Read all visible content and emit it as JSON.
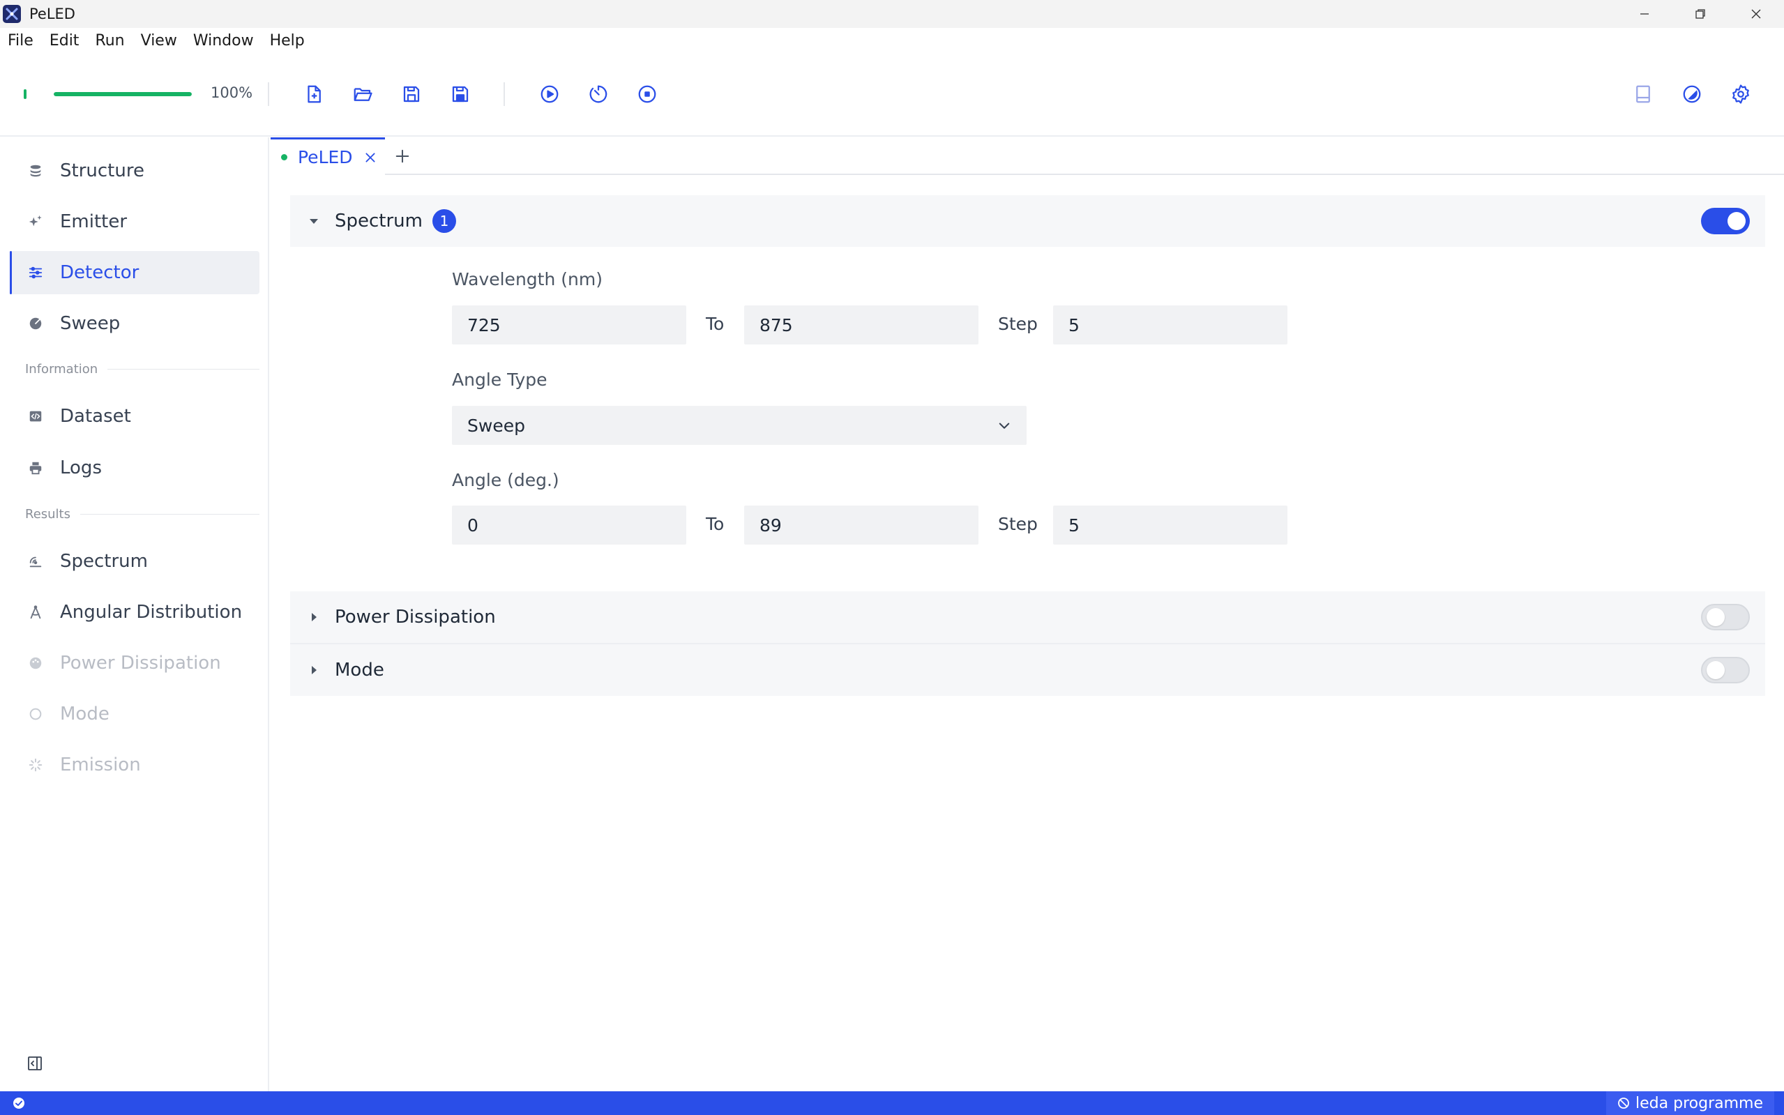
{
  "window": {
    "title": "PeLED"
  },
  "menu": [
    "File",
    "Edit",
    "Run",
    "View",
    "Window",
    "Help"
  ],
  "toolbar": {
    "progress_value": 100,
    "progress_text": "100%"
  },
  "sidebar": {
    "items": [
      {
        "label": "Structure"
      },
      {
        "label": "Emitter"
      },
      {
        "label": "Detector"
      },
      {
        "label": "Sweep"
      }
    ],
    "information_title": "Information",
    "information_items": [
      {
        "label": "Dataset"
      },
      {
        "label": "Logs"
      }
    ],
    "results_title": "Results",
    "results_items": [
      {
        "label": "Spectrum"
      },
      {
        "label": "Angular Distribution"
      },
      {
        "label": "Power Dissipation"
      },
      {
        "label": "Mode"
      },
      {
        "label": "Emission"
      }
    ]
  },
  "tabs": [
    {
      "label": "PeLED"
    }
  ],
  "panel": {
    "spectrum": {
      "title": "Spectrum",
      "badge": "1",
      "enabled": true,
      "wavelength_label": "Wavelength (nm)",
      "wavelength_from": "725",
      "wavelength_to": "875",
      "wavelength_step": "5",
      "to_label": "To",
      "step_label": "Step",
      "angle_type_label": "Angle Type",
      "angle_type_value": "Sweep",
      "angle_label": "Angle (deg.)",
      "angle_from": "0",
      "angle_to": "89",
      "angle_step": "5"
    },
    "power_dissipation": {
      "title": "Power Dissipation",
      "enabled": false
    },
    "mode": {
      "title": "Mode",
      "enabled": false
    }
  },
  "statusbar": {
    "right_text": "leda programme"
  },
  "colors": {
    "accent": "#2a4ee8",
    "success": "#16b364"
  }
}
